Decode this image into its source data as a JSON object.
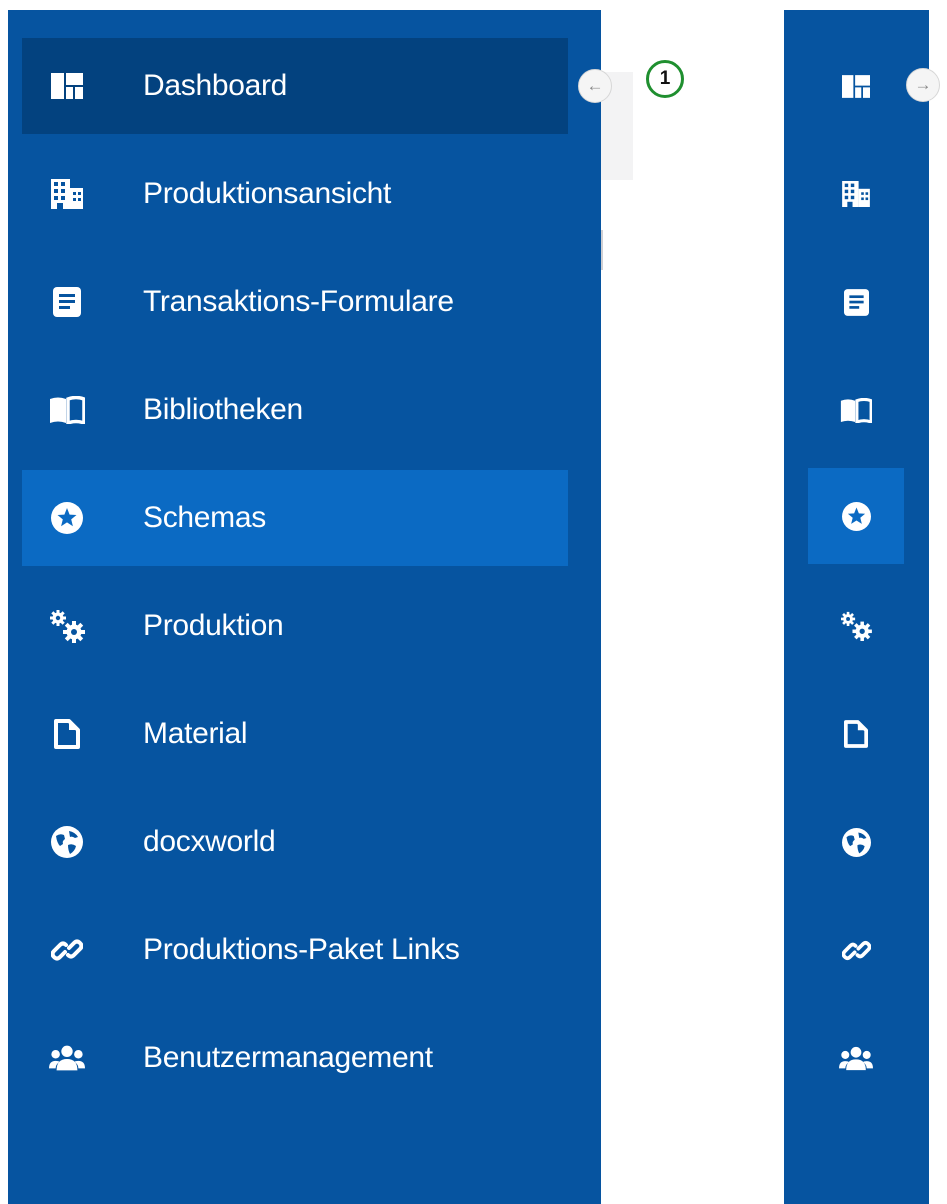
{
  "sidebar_expanded": {
    "items": [
      {
        "label": "Dashboard",
        "icon": "dashboard-icon"
      },
      {
        "label": "Produktionsansicht",
        "icon": "building-icon"
      },
      {
        "label": "Transaktions-Formulare",
        "icon": "form-document-icon"
      },
      {
        "label": "Bibliotheken",
        "icon": "open-book-icon"
      },
      {
        "label": "Schemas",
        "icon": "star-circle-icon"
      },
      {
        "label": "Produktion",
        "icon": "gears-icon"
      },
      {
        "label": "Material",
        "icon": "file-icon"
      },
      {
        "label": "docxworld",
        "icon": "globe-icon"
      },
      {
        "label": "Produktions-Paket Links",
        "icon": "link-icon"
      },
      {
        "label": "Benutzermanagement",
        "icon": "users-icon"
      }
    ],
    "active_item": "Dashboard",
    "selected_item": "Schemas",
    "collapse_button": {
      "icon": "arrow-left-icon",
      "glyph": "←"
    }
  },
  "sidebar_collapsed": {
    "expand_button": {
      "icon": "arrow-right-icon",
      "glyph": "→"
    }
  },
  "callout": {
    "number": "1",
    "color": "#1f8f2f"
  },
  "colors": {
    "sidebar_bg": "#0654a0",
    "active_bg": "#03427f",
    "selected_bg": "#0b6ac3",
    "text": "#ffffff"
  }
}
